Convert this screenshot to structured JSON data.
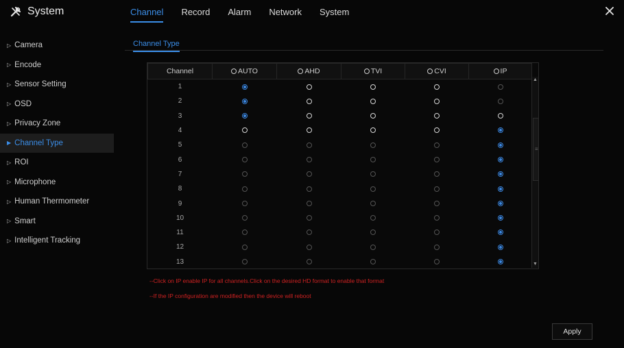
{
  "app": {
    "title": "System",
    "icon": "tools-icon"
  },
  "top_tabs": [
    {
      "label": "Channel",
      "active": true
    },
    {
      "label": "Record",
      "active": false
    },
    {
      "label": "Alarm",
      "active": false
    },
    {
      "label": "Network",
      "active": false
    },
    {
      "label": "System",
      "active": false
    }
  ],
  "sidebar": {
    "items": [
      {
        "label": "Camera"
      },
      {
        "label": "Encode"
      },
      {
        "label": "Sensor Setting"
      },
      {
        "label": "OSD"
      },
      {
        "label": "Privacy Zone"
      },
      {
        "label": "Channel Type",
        "active": true
      },
      {
        "label": "ROI"
      },
      {
        "label": "Microphone"
      },
      {
        "label": "Human Thermometer"
      },
      {
        "label": "Smart"
      },
      {
        "label": "Intelligent Tracking"
      }
    ]
  },
  "sub_tab": {
    "label": "Channel Type"
  },
  "table": {
    "headers": [
      "Channel",
      "AUTO",
      "AHD",
      "TVI",
      "CVI",
      "IP"
    ],
    "rows": [
      {
        "channel": "1",
        "selected": "AUTO",
        "bold": [
          "AHD",
          "TVI",
          "CVI"
        ]
      },
      {
        "channel": "2",
        "selected": "AUTO",
        "bold": [
          "AHD",
          "TVI",
          "CVI"
        ]
      },
      {
        "channel": "3",
        "selected": "AUTO",
        "bold": [
          "AHD",
          "TVI",
          "CVI",
          "IP"
        ]
      },
      {
        "channel": "4",
        "selected": "IP",
        "bold": [
          "AUTO",
          "AHD",
          "TVI",
          "CVI"
        ]
      },
      {
        "channel": "5",
        "selected": "IP",
        "bold": []
      },
      {
        "channel": "6",
        "selected": "IP",
        "bold": []
      },
      {
        "channel": "7",
        "selected": "IP",
        "bold": []
      },
      {
        "channel": "8",
        "selected": "IP",
        "bold": []
      },
      {
        "channel": "9",
        "selected": "IP",
        "bold": []
      },
      {
        "channel": "10",
        "selected": "IP",
        "bold": []
      },
      {
        "channel": "11",
        "selected": "IP",
        "bold": []
      },
      {
        "channel": "12",
        "selected": "IP",
        "bold": []
      },
      {
        "channel": "13",
        "selected": "IP",
        "bold": []
      }
    ]
  },
  "notes": [
    "--Click on IP enable IP for all channels.Click on the desired HD format to enable that format",
    "--If the IP configuration are modified then the device will reboot"
  ],
  "apply_label": "Apply",
  "colors": {
    "accent": "#3b8ee8",
    "warning": "#d02222",
    "background": "#070707"
  }
}
